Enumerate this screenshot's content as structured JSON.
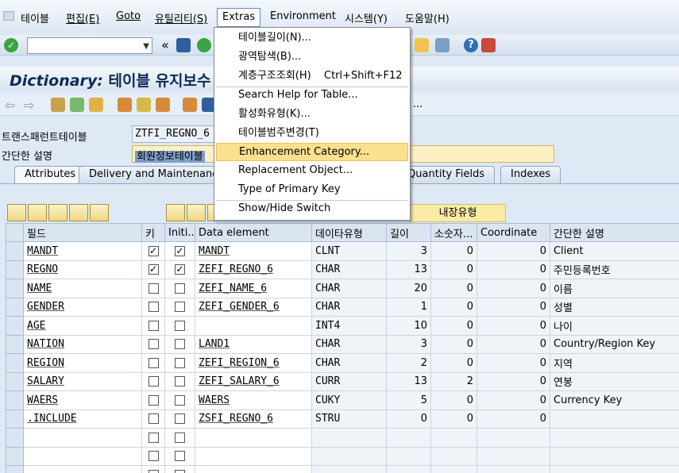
{
  "menubar": {
    "items": [
      "테이블",
      "편집(E)",
      "Goto",
      "유틸리티(S)",
      "Extras",
      "Environment",
      "시스템(Y)",
      "도움말(H)"
    ]
  },
  "title": {
    "prefix": "Dictionary:",
    "rest": " 테이블 유지보수"
  },
  "header": {
    "table_label": "트랜스패런트테이블",
    "table_value": "ZTFI_REGNO_6",
    "desc_label": "간단한 설명",
    "desc_value": "회원정보테이블"
  },
  "tabs": [
    "Attributes",
    "Delivery and Maintenance",
    "y/Quantity Fields",
    "Indexes"
  ],
  "extras_menu": {
    "items": [
      {
        "label": "테이블길이(N)..."
      },
      {
        "label": "광역탐색(B)..."
      },
      {
        "label": "계층구조조회(H)",
        "shortcut": "Ctrl+Shift+F12"
      },
      {
        "label": "Search Help for Table..."
      },
      {
        "label": "활성화유형(K)..."
      },
      {
        "label": "테이블범주변경(T)"
      },
      {
        "label": "Enhancement Category..."
      },
      {
        "label": "Replacement Object..."
      },
      {
        "label": "Type of Primary Key"
      },
      {
        "label": "Show/Hide Switch"
      }
    ]
  },
  "naejang_button": "내장유형",
  "grid": {
    "headers": [
      "필드",
      "키",
      "Initi...",
      "Data element",
      "데이타유형",
      "길이",
      "소숫자...",
      "Coordinate",
      "간단한 설명"
    ],
    "rows": [
      {
        "field": "MANDT",
        "key": true,
        "init": true,
        "element": "MANDT",
        "type": "CLNT",
        "len": "3",
        "dec": "0",
        "coord": "0",
        "desc": "Client"
      },
      {
        "field": "REGNO",
        "key": true,
        "init": true,
        "element": "ZEFI_REGNO_6",
        "type": "CHAR",
        "len": "13",
        "dec": "0",
        "coord": "0",
        "desc": "주민등록번호"
      },
      {
        "field": "NAME",
        "key": false,
        "init": false,
        "element": "ZEFI_NAME_6",
        "type": "CHAR",
        "len": "20",
        "dec": "0",
        "coord": "0",
        "desc": "이름"
      },
      {
        "field": "GENDER",
        "key": false,
        "init": false,
        "element": "ZEFI_GENDER_6",
        "type": "CHAR",
        "len": "1",
        "dec": "0",
        "coord": "0",
        "desc": "성별"
      },
      {
        "field": "AGE",
        "key": false,
        "init": false,
        "element": "",
        "type": "INT4",
        "len": "10",
        "dec": "0",
        "coord": "0",
        "desc": "나이"
      },
      {
        "field": "NATION",
        "key": false,
        "init": false,
        "element": "LAND1",
        "type": "CHAR",
        "len": "3",
        "dec": "0",
        "coord": "0",
        "desc": "Country/Region Key"
      },
      {
        "field": "REGION",
        "key": false,
        "init": false,
        "element": "ZEFI_REGION_6",
        "type": "CHAR",
        "len": "2",
        "dec": "0",
        "coord": "0",
        "desc": "지역"
      },
      {
        "field": "SALARY",
        "key": false,
        "init": false,
        "element": "ZEFI_SALARY_6",
        "type": "CURR",
        "len": "13",
        "dec": "2",
        "coord": "0",
        "desc": "연봉"
      },
      {
        "field": "WAERS",
        "key": false,
        "init": false,
        "element": "WAERS",
        "type": "CUKY",
        "len": "5",
        "dec": "0",
        "coord": "0",
        "desc": "Currency Key"
      },
      {
        "field": ".INCLUDE",
        "key": false,
        "init": false,
        "element": "ZSFI_REGNO_6",
        "type": "STRU",
        "len": "0",
        "dec": "0",
        "coord": "0",
        "desc": ""
      }
    ]
  }
}
